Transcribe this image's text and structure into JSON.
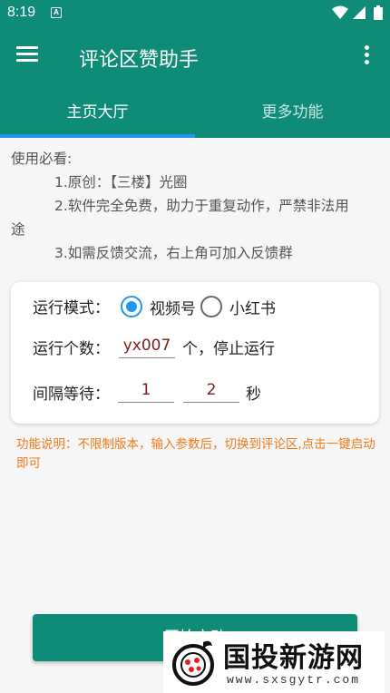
{
  "status_bar": {
    "time": "8:19",
    "notification_badge": "A",
    "icons": [
      "wifi-icon",
      "signal-icon",
      "battery-icon"
    ]
  },
  "app_bar": {
    "title": "评论区赞助手",
    "menu_icon": "hamburger-menu-icon",
    "more_icon": "more-vert-icon"
  },
  "tabs": [
    {
      "label": "主页大厅",
      "selected": true
    },
    {
      "label": "更多功能",
      "selected": false
    }
  ],
  "intro": {
    "heading": "使用必看:",
    "line1": "1.原创：【三楼】光圈",
    "line2_a": "2.软件完全免费，助力于重复动作，严禁非法用",
    "line2_b": "途",
    "line3": "3.如需反馈交流，右上角可加入反馈群"
  },
  "settings": {
    "mode_label": "运行模式：",
    "mode_options": [
      {
        "label": "视频号",
        "selected": true
      },
      {
        "label": "小红书",
        "selected": false
      }
    ],
    "count_label": "运行个数：",
    "count_value": "yx007",
    "count_suffix": "个，停止运行",
    "interval_label": "间隔等待：",
    "interval_min": "1",
    "interval_max": "2",
    "interval_unit": "秒"
  },
  "note": "功能说明：不限制版本，输入参数后，切换到评论区,点击一键启动即可",
  "start_button": {
    "label": "开始启动"
  },
  "watermark": {
    "brand": "国投新游网",
    "url": "www.sxsgytr.com"
  },
  "colors": {
    "primary": "#0f8c78",
    "accent": "#2196f3",
    "note": "#f07a1a",
    "input_text": "#7a1f1f"
  }
}
